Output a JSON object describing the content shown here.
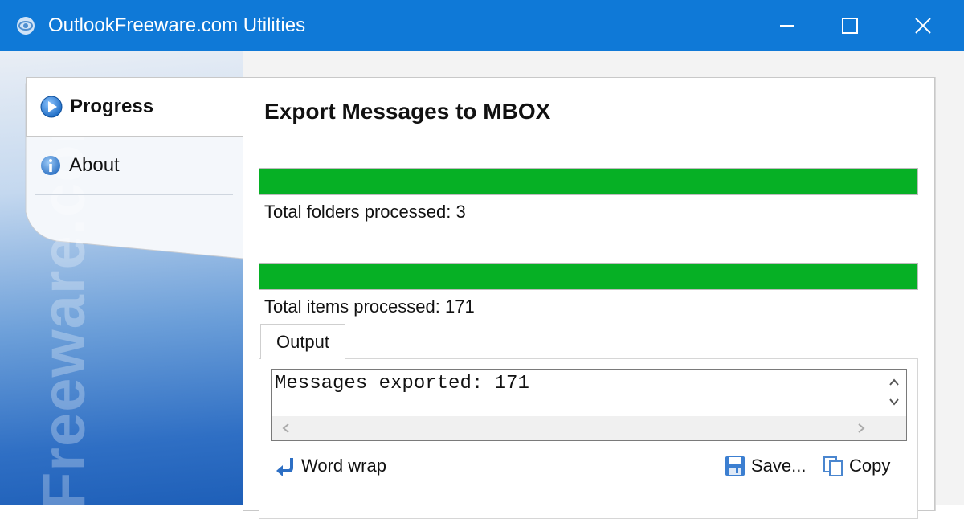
{
  "window": {
    "title": "OutlookFreeware.com Utilities",
    "controls": [
      "minimize-icon",
      "maximize-icon",
      "close-icon"
    ]
  },
  "sidebar": {
    "watermark": "Freeware.com",
    "items": [
      {
        "label": "Progress",
        "icon": "play-circle-icon",
        "active": true
      },
      {
        "label": "About",
        "icon": "info-icon",
        "active": false
      }
    ]
  },
  "main": {
    "title": "Export Messages to MBOX",
    "progress": [
      {
        "label": "Total folders processed: 3",
        "value": 1.0
      },
      {
        "label": "Total items processed: 171",
        "value": 1.0
      }
    ],
    "output": {
      "tab_label": "Output",
      "text": "Messages exported: 171",
      "word_wrap_label": "Word wrap",
      "save_label": "Save...",
      "copy_label": "Copy"
    }
  },
  "colors": {
    "titlebar": "#0f79d7",
    "progress_fill": "#06b025",
    "accent": "#1e5fb8"
  }
}
